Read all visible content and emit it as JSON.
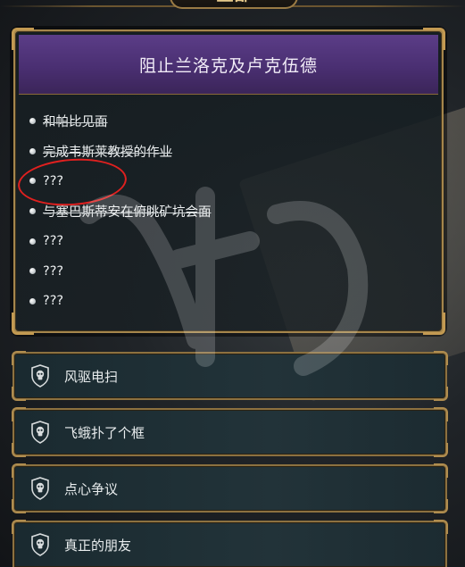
{
  "header": {
    "tab_label": "全部"
  },
  "quest": {
    "title": "阻止兰洛克及卢克伍德",
    "objectives": [
      {
        "text": "和帕比见面",
        "completed": true
      },
      {
        "text": "完成韦斯莱教授的作业",
        "completed": true
      },
      {
        "text": "???",
        "completed": false
      },
      {
        "text": "与塞巴斯蒂安在俯眺矿坑会面",
        "completed": true
      },
      {
        "text": "???",
        "completed": false
      },
      {
        "text": "???",
        "completed": false
      },
      {
        "text": "???",
        "completed": false
      }
    ]
  },
  "quest_list": [
    {
      "label": "风驱电扫",
      "icon": "shield-skull-icon"
    },
    {
      "label": "飞蛾扑了个框",
      "icon": "shield-skull-icon"
    },
    {
      "label": "点心争议",
      "icon": "shield-skull-icon"
    },
    {
      "label": "真正的朋友",
      "icon": "shield-skull-icon"
    }
  ],
  "colors": {
    "header_purple": "#4a2f72",
    "frame_gold": "#a5864c",
    "annotation_red": "#e0201f"
  }
}
